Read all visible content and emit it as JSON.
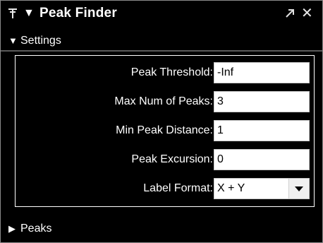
{
  "window": {
    "title": "Peak Finder",
    "pin_icon": "pin-icon",
    "collapse_icon": "triangle-down-icon",
    "undock_icon": "arrow-up-right-icon",
    "close_icon": "close-icon"
  },
  "settings": {
    "header": "Settings",
    "expanded": true,
    "fields": [
      {
        "label": "Peak Threshold:",
        "value": "-Inf"
      },
      {
        "label": "Max Num of Peaks:",
        "value": "3"
      },
      {
        "label": "Min Peak Distance:",
        "value": "1"
      },
      {
        "label": "Peak Excursion:",
        "value": "0"
      },
      {
        "label": "Label Format:",
        "value": "X + Y"
      }
    ]
  },
  "peaks": {
    "header": "Peaks",
    "expanded": false
  },
  "colors": {
    "panel_background": "#000000",
    "text": "#ffffff",
    "field_background": "#ffffff"
  }
}
